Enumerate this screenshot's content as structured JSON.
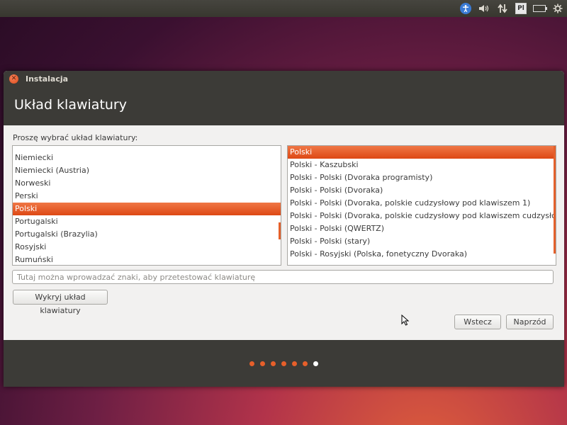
{
  "topbar": {
    "keyboard_indicator": "Pl",
    "icons": [
      "accessibility-icon",
      "volume-icon",
      "network-icon",
      "keyboard-layout-icon",
      "battery-icon",
      "gear-icon"
    ]
  },
  "window": {
    "title": "Instalacja",
    "heading": "Układ klawiatury",
    "prompt": "Proszę wybrać układ klawiatury:",
    "layouts": [
      "Niemiecki",
      "Niemiecki (Austria)",
      "Norweski",
      "Perski",
      "Polski",
      "Portugalski",
      "Portugalski (Brazylia)",
      "Rosyjski",
      "Rumuński"
    ],
    "selected_layout": "Polski",
    "variants": [
      "Polski",
      "Polski - Kaszubski",
      "Polski - Polski (Dvoraka programisty)",
      "Polski - Polski (Dvoraka)",
      "Polski - Polski (Dvoraka, polskie cudzysłowy pod klawiszem 1)",
      "Polski - Polski (Dvoraka, polskie cudzysłowy pod klawiszem cudzysłowu)",
      "Polski - Polski (QWERTZ)",
      "Polski - Polski (stary)",
      "Polski - Rosyjski (Polska, fonetyczny Dvoraka)"
    ],
    "selected_variant": "Polski",
    "test_input": {
      "value": "",
      "placeholder": "Tutaj można wprowadzać znaki, aby przetestować klawiaturę"
    },
    "detect_button": "Wykryj układ klawiatury",
    "back_button": "Wstecz",
    "next_button": "Naprzód",
    "progress": {
      "total_steps": 7,
      "current_step": 7
    }
  },
  "colors": {
    "accent": "#dd4814",
    "header_bg": "#3c3b37",
    "window_bg": "#f2f1f0"
  }
}
